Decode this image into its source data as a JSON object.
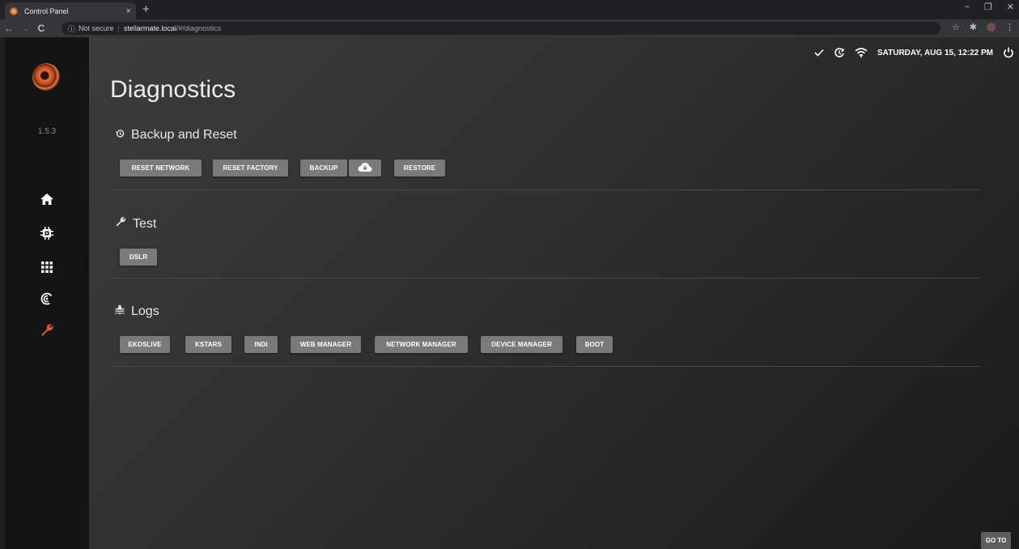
{
  "browser": {
    "tab_title": "Control Panel",
    "tab_close": "×",
    "new_tab": "+",
    "not_secure": "Not secure",
    "url_host": "stellarmate.local",
    "url_path": "/#/diagnostics"
  },
  "app": {
    "version": "1.5.3",
    "accent_color": "#e0533a",
    "nav": [
      {
        "icon": "home-icon"
      },
      {
        "icon": "chip-icon"
      },
      {
        "icon": "apps-grid-icon"
      },
      {
        "icon": "broadcast-icon"
      },
      {
        "icon": "wrench-icon",
        "active": true
      }
    ]
  },
  "status_bar": {
    "datetime": "SATURDAY, AUG 15, 12:22 PM",
    "icons": [
      "check-icon",
      "sync-icon",
      "wifi-icon",
      "power-icon"
    ]
  },
  "page": {
    "title": "Diagnostics",
    "sections": {
      "backup": {
        "heading": "Backup and Reset",
        "buttons": {
          "reset_network": "RESET NETWORK",
          "reset_factory": "RESET FACTORY",
          "backup": "BACKUP",
          "restore": "RESTORE"
        }
      },
      "test": {
        "heading": "Test",
        "buttons": {
          "dslr": "DSLR"
        }
      },
      "logs": {
        "heading": "Logs",
        "buttons": {
          "ekoslive": "EKOSLIVE",
          "kstars": "KSTARS",
          "indi": "INDI",
          "web_manager": "WEB MANAGER",
          "network_manager": "NETWORK MANAGER",
          "device_manager": "DEVICE MANAGER",
          "boot": "BOOT"
        }
      }
    },
    "goto": "GO TO"
  }
}
